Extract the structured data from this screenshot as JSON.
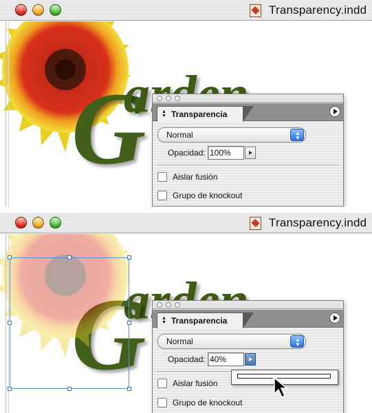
{
  "window": {
    "title": "Transparency.indd",
    "doc_icon": "indesign-document-icon",
    "traffic_lights": [
      "close",
      "minimize",
      "zoom"
    ]
  },
  "artwork": {
    "word": "Garden",
    "colors": {
      "flower_outer": "#e8d41c",
      "flower_mid": "#d6281a",
      "flower_center": "#4a1a0a",
      "text_green": "#3f5a12",
      "selection": "#5a8fd6"
    }
  },
  "palette": {
    "tab_label": "Transparencia",
    "blend_mode": "Normal",
    "opacity_label": "Opacidad:",
    "isolate_label": "Aislar fusión",
    "knockout_label": "Grupo de knockout"
  },
  "states": [
    {
      "opacity_value": "100%",
      "slider_open": false,
      "image_faded": false
    },
    {
      "opacity_value": "40%",
      "slider_open": true,
      "slider_level": 0.4,
      "image_faded": true
    }
  ]
}
